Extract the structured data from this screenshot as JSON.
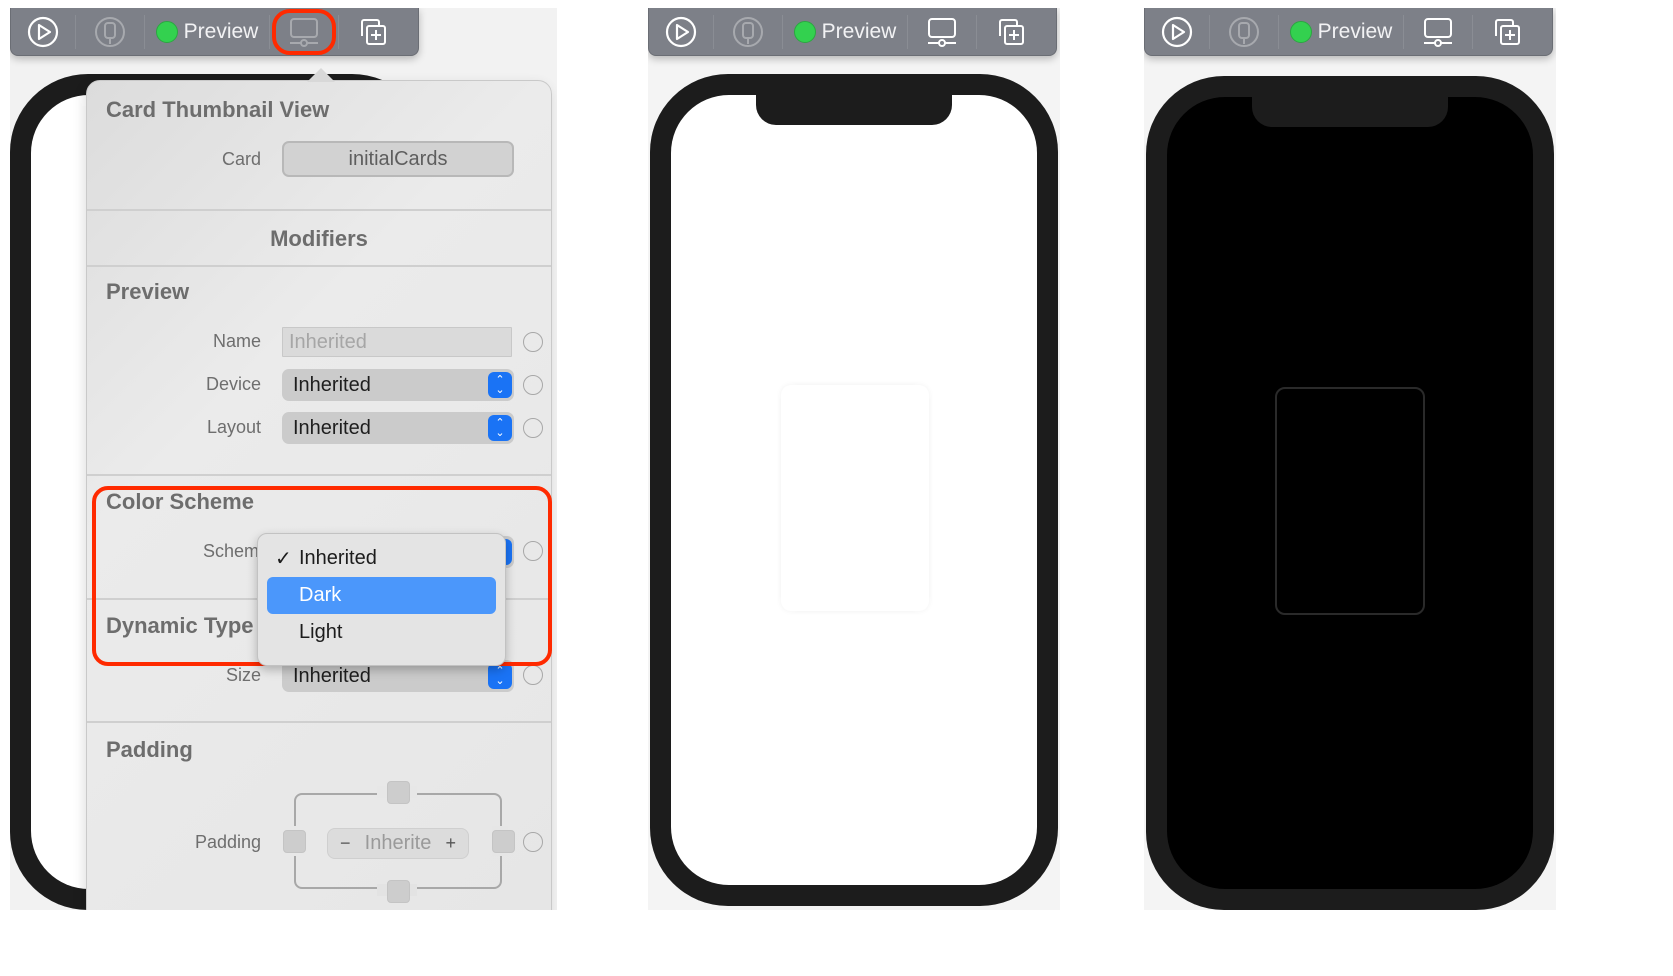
{
  "toolbar": {
    "preview_label": "Preview",
    "icons": [
      "play-circle-icon",
      "device-icon",
      "live-status-dot",
      "preview-settings-icon",
      "duplicate-preview-icon"
    ],
    "status_color": "#33d14f"
  },
  "inspector": {
    "title": "Card Thumbnail View",
    "card_label": "Card",
    "card_value": "initialCards",
    "modifiers_heading": "Modifiers",
    "preview_section": {
      "title": "Preview",
      "name_label": "Name",
      "name_placeholder": "Inherited",
      "device_label": "Device",
      "device_value": "Inherited",
      "layout_label": "Layout",
      "layout_value": "Inherited"
    },
    "color_scheme_section": {
      "title": "Color Scheme",
      "scheme_label": "Scheme",
      "menu": {
        "items": [
          {
            "label": "Inherited",
            "checked": true,
            "highlighted": false
          },
          {
            "label": "Dark",
            "checked": false,
            "highlighted": true
          },
          {
            "label": "Light",
            "checked": false,
            "highlighted": false
          }
        ],
        "check_glyph": "✓"
      }
    },
    "dynamic_type_section": {
      "title": "Dynamic Type",
      "size_label": "Size",
      "size_value": "Inherited"
    },
    "padding_section": {
      "title": "Padding",
      "padding_label": "Padding",
      "stepper_value": "Inherite",
      "minus": "−",
      "plus": "+"
    }
  },
  "previews": [
    {
      "scheme": "light",
      "screen_color": "#ffffff"
    },
    {
      "scheme": "light",
      "screen_color": "#ffffff"
    },
    {
      "scheme": "dark",
      "screen_color": "#000000"
    }
  ],
  "highlight_color": "#ff2a00",
  "accent_color": "#1a73f5"
}
